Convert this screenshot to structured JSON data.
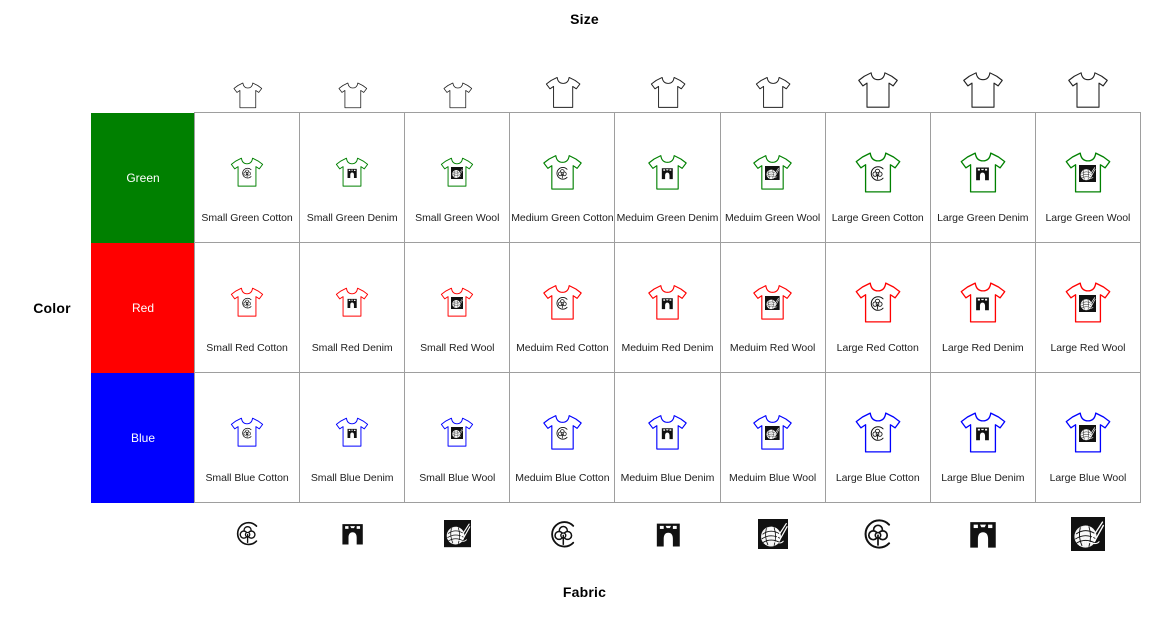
{
  "axes": {
    "top_title": "Size",
    "bottom_title": "Fabric",
    "left_title": "Color"
  },
  "colors": {
    "green": "#008000",
    "red": "#FF0000",
    "blue": "#0000FF",
    "grid_line": "#9e9e9e",
    "header_text": "#ffffff",
    "label_text": "#222222"
  },
  "row_headers": [
    {
      "label": "Green",
      "swatch": "#008000"
    },
    {
      "label": "Red",
      "swatch": "#FF0000"
    },
    {
      "label": "Blue",
      "swatch": "#0000FF"
    }
  ],
  "size_headers": [
    {
      "size": "Small",
      "icon": "tshirt-icon",
      "scale": 0.72
    },
    {
      "size": "Small",
      "icon": "tshirt-icon",
      "scale": 0.72
    },
    {
      "size": "Small",
      "icon": "tshirt-icon",
      "scale": 0.72
    },
    {
      "size": "Medium",
      "icon": "tshirt-icon",
      "scale": 0.87
    },
    {
      "size": "Medium",
      "icon": "tshirt-icon",
      "scale": 0.87
    },
    {
      "size": "Medium",
      "icon": "tshirt-icon",
      "scale": 0.87
    },
    {
      "size": "Large",
      "icon": "tshirt-icon",
      "scale": 1.0
    },
    {
      "size": "Large",
      "icon": "tshirt-icon",
      "scale": 1.0
    },
    {
      "size": "Large",
      "icon": "tshirt-icon",
      "scale": 1.0
    }
  ],
  "fabric_footers": [
    {
      "fabric": "Cotton",
      "icon": "cotton-flower-icon",
      "scale": 0.8
    },
    {
      "fabric": "Denim",
      "icon": "denim-jeans-icon",
      "scale": 0.8
    },
    {
      "fabric": "Wool",
      "icon": "wool-yarn-icon",
      "scale": 0.8
    },
    {
      "fabric": "Cotton",
      "icon": "cotton-flower-icon",
      "scale": 0.9
    },
    {
      "fabric": "Denim",
      "icon": "denim-jeans-icon",
      "scale": 0.9
    },
    {
      "fabric": "Wool",
      "icon": "wool-yarn-icon",
      "scale": 0.9
    },
    {
      "fabric": "Cotton",
      "icon": "cotton-flower-icon",
      "scale": 1.0
    },
    {
      "fabric": "Denim",
      "icon": "denim-jeans-icon",
      "scale": 1.0
    },
    {
      "fabric": "Wool",
      "icon": "wool-yarn-icon",
      "scale": 1.0
    }
  ],
  "rows": [
    {
      "color": "Green",
      "swatch": "#008000",
      "cells": [
        {
          "label": "Small Green Cotton",
          "fabric": "cotton-flower-icon",
          "shirt_scale": 0.72
        },
        {
          "label": "Small Green Denim",
          "fabric": "denim-jeans-icon",
          "shirt_scale": 0.72
        },
        {
          "label": "Small Green Wool",
          "fabric": "wool-yarn-icon",
          "shirt_scale": 0.72
        },
        {
          "label": "Medium Green Cotton",
          "fabric": "cotton-flower-icon",
          "shirt_scale": 0.86
        },
        {
          "label": "Meduim Green Denim",
          "fabric": "denim-jeans-icon",
          "shirt_scale": 0.86
        },
        {
          "label": "Meduim Green Wool",
          "fabric": "wool-yarn-icon",
          "shirt_scale": 0.86
        },
        {
          "label": "Large Green Cotton",
          "fabric": "cotton-flower-icon",
          "shirt_scale": 1.0
        },
        {
          "label": "Large Green Denim",
          "fabric": "denim-jeans-icon",
          "shirt_scale": 1.0
        },
        {
          "label": "Large Green Wool",
          "fabric": "wool-yarn-icon",
          "shirt_scale": 1.0
        }
      ]
    },
    {
      "color": "Red",
      "swatch": "#FF0000",
      "cells": [
        {
          "label": "Small Red Cotton",
          "fabric": "cotton-flower-icon",
          "shirt_scale": 0.72
        },
        {
          "label": "Small Red Denim",
          "fabric": "denim-jeans-icon",
          "shirt_scale": 0.72
        },
        {
          "label": "Small Red Wool",
          "fabric": "wool-yarn-icon",
          "shirt_scale": 0.72
        },
        {
          "label": "Meduim Red Cotton",
          "fabric": "cotton-flower-icon",
          "shirt_scale": 0.86
        },
        {
          "label": "Meduim Red Denim",
          "fabric": "denim-jeans-icon",
          "shirt_scale": 0.86
        },
        {
          "label": "Meduim Red Wool",
          "fabric": "wool-yarn-icon",
          "shirt_scale": 0.86
        },
        {
          "label": "Large Red Cotton",
          "fabric": "cotton-flower-icon",
          "shirt_scale": 1.0
        },
        {
          "label": "Large Red Denim",
          "fabric": "denim-jeans-icon",
          "shirt_scale": 1.0
        },
        {
          "label": "Large Red Wool",
          "fabric": "wool-yarn-icon",
          "shirt_scale": 1.0
        }
      ]
    },
    {
      "color": "Blue",
      "swatch": "#0000FF",
      "cells": [
        {
          "label": "Small Blue Cotton",
          "fabric": "cotton-flower-icon",
          "shirt_scale": 0.72
        },
        {
          "label": "Small Blue Denim",
          "fabric": "denim-jeans-icon",
          "shirt_scale": 0.72
        },
        {
          "label": "Small Blue Wool",
          "fabric": "wool-yarn-icon",
          "shirt_scale": 0.72
        },
        {
          "label": "Meduim Blue Cotton",
          "fabric": "cotton-flower-icon",
          "shirt_scale": 0.86
        },
        {
          "label": "Meduim Blue Denim",
          "fabric": "denim-jeans-icon",
          "shirt_scale": 0.86
        },
        {
          "label": "Meduim Blue Wool",
          "fabric": "wool-yarn-icon",
          "shirt_scale": 0.86
        },
        {
          "label": "Large Blue Cotton",
          "fabric": "cotton-flower-icon",
          "shirt_scale": 1.0
        },
        {
          "label": "Large Blue Denim",
          "fabric": "denim-jeans-icon",
          "shirt_scale": 1.0
        },
        {
          "label": "Large Blue Wool",
          "fabric": "wool-yarn-icon",
          "shirt_scale": 1.0
        }
      ]
    }
  ]
}
